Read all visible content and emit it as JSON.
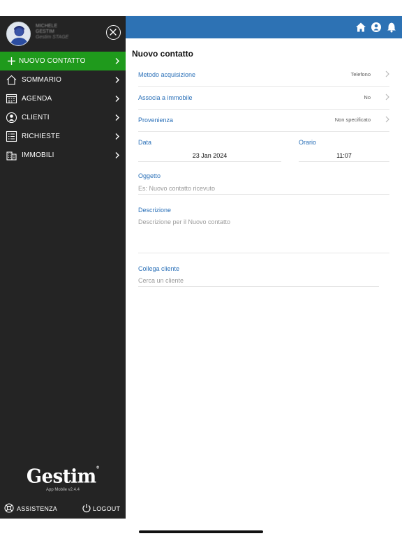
{
  "sidebar": {
    "profile": {
      "name_line1": "MICHELE",
      "name_line2": "GESTIM",
      "role": "Gestim STAGE"
    },
    "items": [
      {
        "label": "NUOVO CONTATTO",
        "icon": "plus-icon",
        "active": true
      },
      {
        "label": "SOMMARIO",
        "icon": "home-icon"
      },
      {
        "label": "AGENDA",
        "icon": "calendar-icon"
      },
      {
        "label": "CLIENTI",
        "icon": "user-icon"
      },
      {
        "label": "RICHIESTE",
        "icon": "list-icon"
      },
      {
        "label": "IMMOBILI",
        "icon": "building-icon"
      }
    ],
    "brand": {
      "logo": "Gestim",
      "version": "App Mobile v2.4.4"
    },
    "footer": {
      "assist_label": "ASSISTENZA",
      "logout_label": "LOGOUT"
    }
  },
  "topbar": {
    "icons": [
      "home-icon",
      "user-icon",
      "bell-icon"
    ],
    "color": "#2d72b4"
  },
  "form": {
    "title": "Nuovo contatto",
    "rows": [
      {
        "label": "Metodo acquisizione",
        "value": "Telefono"
      },
      {
        "label": "Associa a immobile",
        "value": "No"
      },
      {
        "label": "Provenienza",
        "value": "Non specificato"
      }
    ],
    "date": {
      "label": "Data",
      "value": "23 Jan 2024"
    },
    "time": {
      "label": "Orario",
      "value": "11:07"
    },
    "subject": {
      "label": "Oggetto",
      "placeholder": "Es: Nuovo contatto ricevuto"
    },
    "description": {
      "label": "Descrizione",
      "placeholder": "Descrizione per il Nuovo contatto"
    },
    "client": {
      "label": "Collega cliente",
      "placeholder": "Cerca un cliente"
    }
  },
  "colors": {
    "accent_green": "#1f9a1c",
    "accent_blue": "#2d72b4",
    "sidebar_bg": "#242424",
    "label_blue": "#2a70b8"
  }
}
